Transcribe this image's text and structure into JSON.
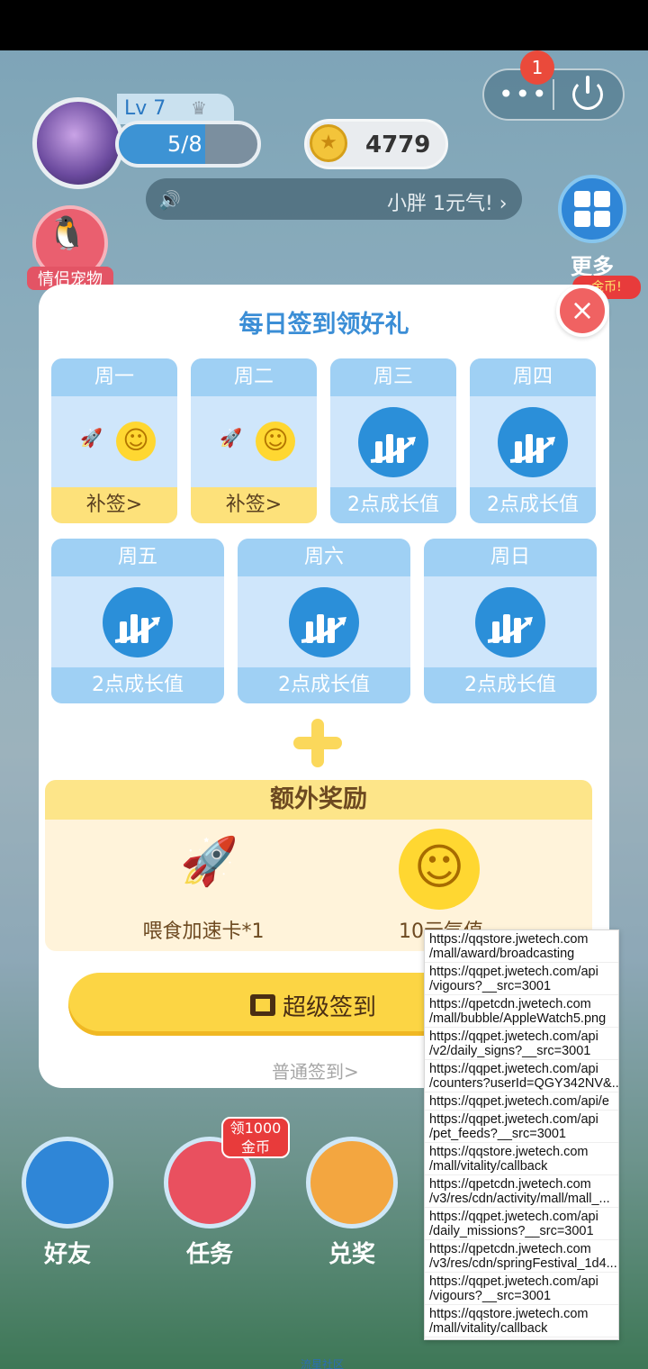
{
  "hud": {
    "level": "Lv 7",
    "xp_text": "5/8",
    "xp_fraction": 0.625,
    "coins": "4779",
    "notification_count": "1",
    "broadcast": "小胖 1元气!",
    "more_label": "更多",
    "pet_label": "情侣宠物",
    "gold_tag": "金币!"
  },
  "modal": {
    "title": "每日签到领好礼",
    "close": "×",
    "days_row1": [
      {
        "label": "周一",
        "foot": "补签>",
        "state": "makeup"
      },
      {
        "label": "周二",
        "foot": "补签>",
        "state": "makeup"
      },
      {
        "label": "周三",
        "foot": "2点成长值",
        "state": "growth"
      },
      {
        "label": "周四",
        "foot": "2点成长值",
        "state": "growth"
      }
    ],
    "days_row2": [
      {
        "label": "周五",
        "foot": "2点成长值",
        "state": "growth"
      },
      {
        "label": "周六",
        "foot": "2点成长值",
        "state": "growth"
      },
      {
        "label": "周日",
        "foot": "2点成长值",
        "state": "growth"
      }
    ],
    "extra_title": "额外奖励",
    "extra_rewards": [
      "喂食加速卡*1",
      "10元气值"
    ],
    "super_sign": "超级签到",
    "normal_sign": "普通签到>"
  },
  "nav": {
    "friends": "好友",
    "tasks": "任务",
    "redeem": "兑奖",
    "task_tag": "领1000\n金币"
  },
  "footer": "流星社区",
  "debug_urls": [
    "https://qqstore.jwetech.com\n/mall/award/broadcasting",
    "https://qqpet.jwetech.com/api\n/vigours?__src=3001",
    "https://qpetcdn.jwetech.com\n/mall/bubble/AppleWatch5.png",
    "https://qqpet.jwetech.com/api\n/v2/daily_signs?__src=3001",
    "https://qqpet.jwetech.com/api\n/counters?userId=QGY342NV&...",
    "https://qqpet.jwetech.com/api/e",
    "https://qqpet.jwetech.com/api\n/pet_feeds?__src=3001",
    "https://qqstore.jwetech.com\n/mall/vitality/callback",
    "https://qpetcdn.jwetech.com\n/v3/res/cdn/activity/mall/mall_...",
    "https://qqpet.jwetech.com/api\n/daily_missions?__src=3001",
    "https://qpetcdn.jwetech.com\n/v3/res/cdn/springFestival_1d4...",
    "https://qqpet.jwetech.com/api\n/vigours?__src=3001",
    "https://qqstore.jwetech.com\n/mall/vitality/callback"
  ],
  "colors": {
    "accent_blue": "#3b8ed6",
    "card_blue": "#9fd0f4",
    "yellow": "#fcd544",
    "close_red": "#f06262"
  }
}
